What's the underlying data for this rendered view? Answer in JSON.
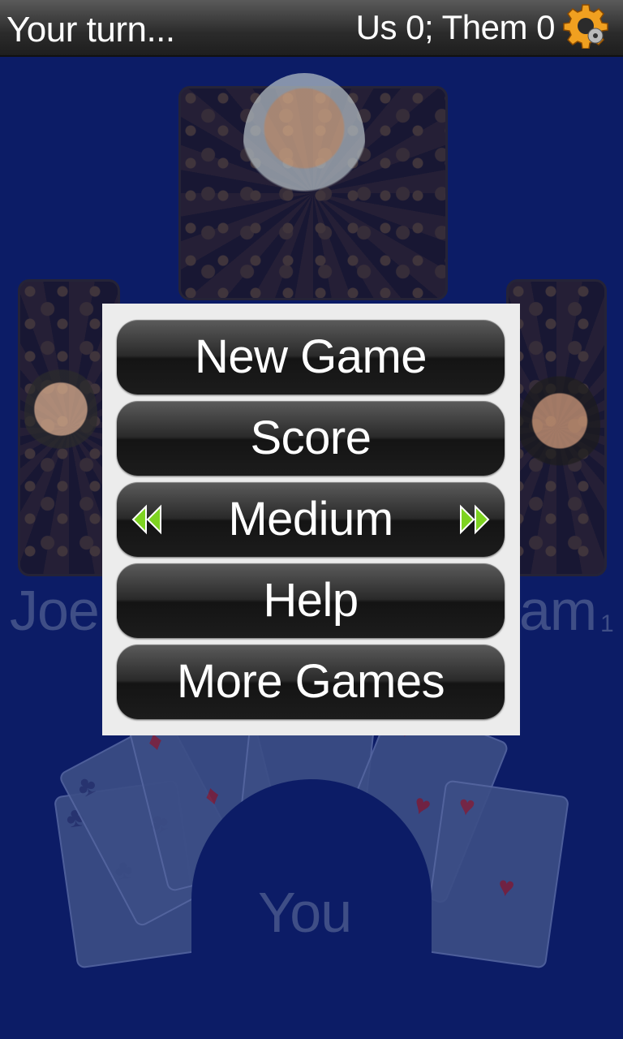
{
  "status_bar": {
    "turn_text": "Your turn...",
    "score_text": "Us 0; Them 0"
  },
  "table": {
    "player_left": "Joe",
    "player_right_partial": "am",
    "player_right_count": "1",
    "player_bottom": "You"
  },
  "menu": {
    "items": [
      {
        "label": "New Game"
      },
      {
        "label": "Score"
      },
      {
        "label": "Medium"
      },
      {
        "label": "Help"
      },
      {
        "label": "More Games"
      }
    ]
  },
  "colors": {
    "table": "#0c1c66",
    "accent_arrow": "#7ed321",
    "gear": "#f0a020"
  }
}
